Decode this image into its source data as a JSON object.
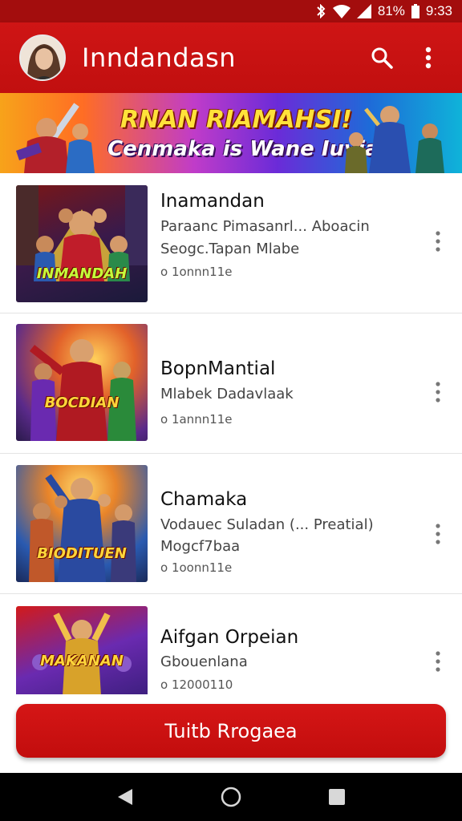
{
  "status_bar": {
    "battery_text": "81%",
    "time": "9:33",
    "icons": [
      "bluetooth-icon",
      "wifi-icon",
      "signal-icon",
      "battery-icon"
    ]
  },
  "app_bar": {
    "title": "Inndandasn",
    "avatar": "avatar",
    "search_icon": "search-icon",
    "overflow_icon": "more-vertical-icon"
  },
  "banner": {
    "line1": "RNAN RIAMAHSI!",
    "line2": "Cenmaka is Wane Iuvian!"
  },
  "list": {
    "items": [
      {
        "thumb_label": "INMANDAH",
        "title": "Inamandan",
        "subtitle": "Paraanc Pimasanrl...  Aboacin",
        "subtitle2": "Seogc.Tapan Mlabe",
        "meta": "o 1onnn11e"
      },
      {
        "thumb_label": "BOCDIAN",
        "title": "BopnMantial",
        "subtitle": "Mlabek Dadavlaak",
        "meta": "o 1annn11e"
      },
      {
        "thumb_label": "BIODITUEN",
        "title": "Chamaka",
        "subtitle": "Vodauec Suladan (...  Preatial)",
        "subtitle2": "Mogcf7baa",
        "meta": "o 1oonn11e"
      },
      {
        "thumb_label": "MAKANAN",
        "title": "Aifgan Orpeian",
        "subtitle": "Gbouenlana",
        "meta": "o 12000110"
      }
    ]
  },
  "cta": {
    "label": "Tuitb Rrogaea"
  },
  "nav": {
    "back": "back-icon",
    "home": "home-icon",
    "recents": "recents-icon"
  },
  "colors": {
    "primary": "#c81212",
    "status": "#a30d0d",
    "nav": "#000000"
  }
}
